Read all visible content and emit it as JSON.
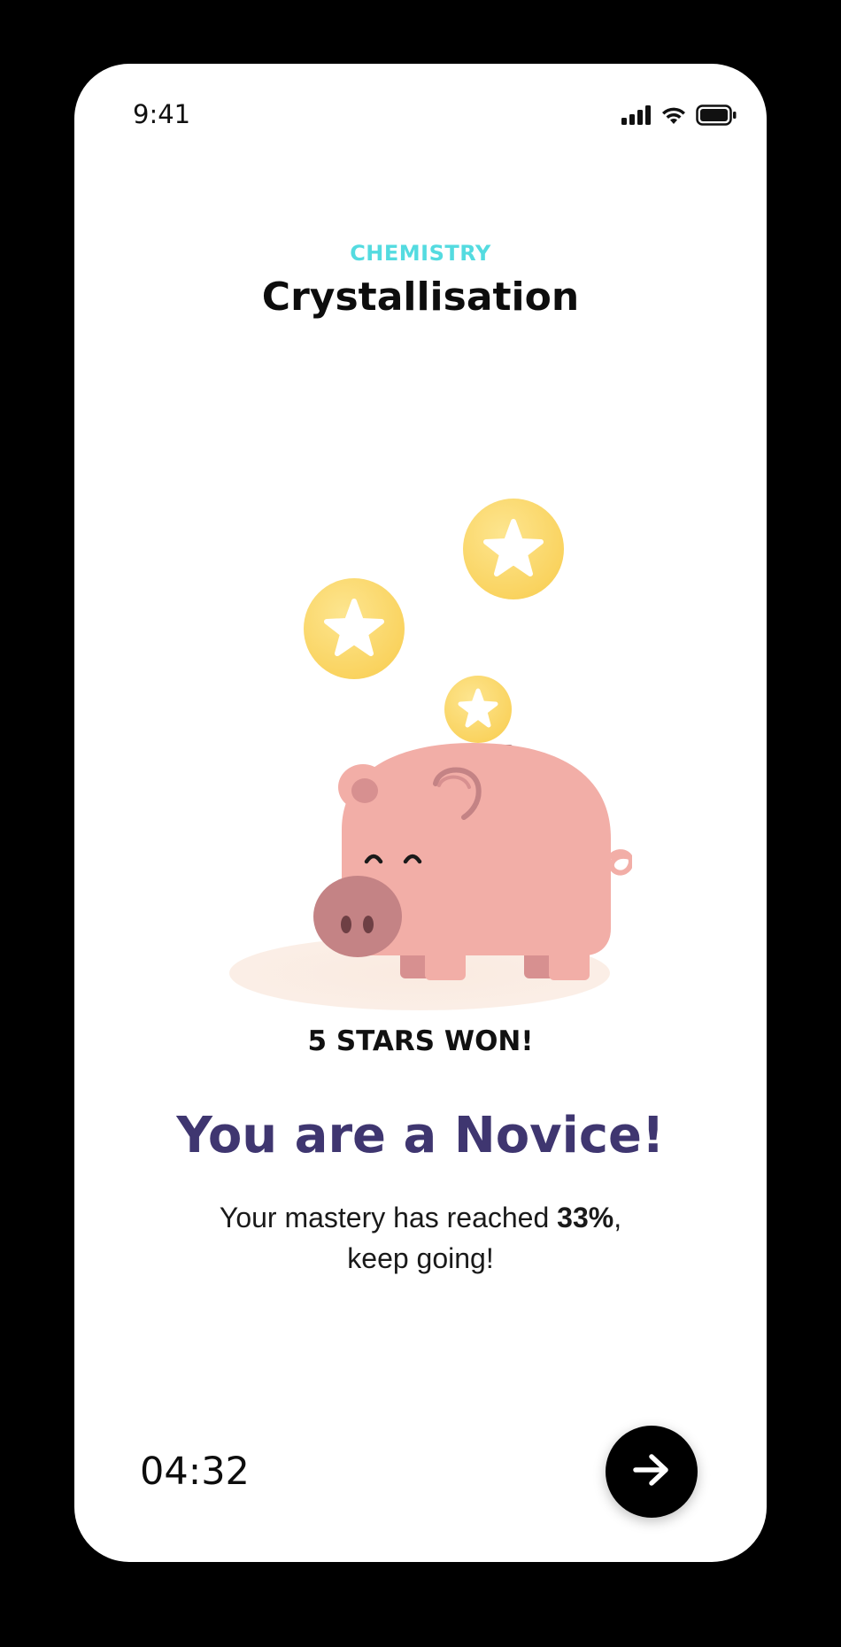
{
  "status_bar": {
    "time": "9:41",
    "icons": [
      "cellular-signal-icon",
      "wifi-icon",
      "battery-icon"
    ]
  },
  "lesson": {
    "subject": "CHEMISTRY",
    "title": "Crystallisation"
  },
  "illustration": {
    "name": "piggy-bank-with-star-coins"
  },
  "result": {
    "stars_won": "5 STARS WON!",
    "stars_count": 5,
    "headline": "You are a Novice!",
    "message_before": "Your mastery has reached ",
    "mastery_percent": "33%",
    "message_after": ",",
    "message_line2": "keep going!"
  },
  "footer": {
    "timer": "04:32",
    "next_icon": "arrow-right-icon"
  },
  "colors": {
    "subject": "#54dbe0",
    "headline": "#3f3670",
    "pig": "#f2aea7",
    "coin": "#fbd969",
    "button": "#000000"
  }
}
